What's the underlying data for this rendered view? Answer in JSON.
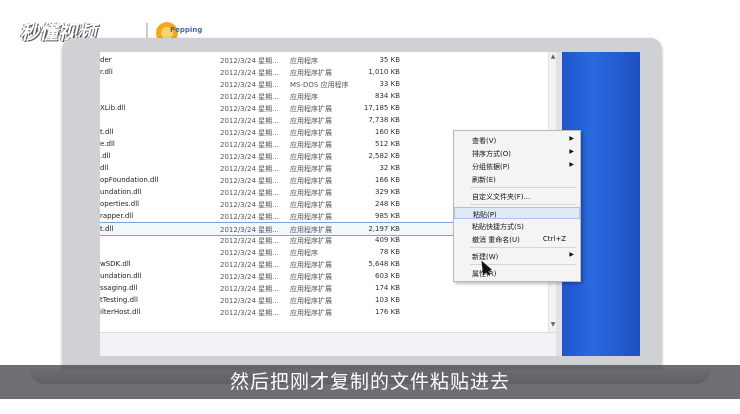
{
  "watermark": {
    "brand": "秒懂视频",
    "partner": "Pepping"
  },
  "files": [
    {
      "name": "der",
      "date": "2012/3/24 星期...",
      "type": "应用程序",
      "size": "35 KB"
    },
    {
      "name": "r.dll",
      "date": "2012/3/24 星期...",
      "type": "应用程序扩展",
      "size": "1,010 KB"
    },
    {
      "name": "",
      "date": "2012/3/24 星期...",
      "type": "MS-DOS 应用程序",
      "size": "33 KB"
    },
    {
      "name": "",
      "date": "2012/3/24 星期...",
      "type": "应用程序",
      "size": "834 KB"
    },
    {
      "name": "XLib.dll",
      "date": "2012/3/24 星期...",
      "type": "应用程序扩展",
      "size": "17,185 KB"
    },
    {
      "name": "",
      "date": "2012/3/24 星期...",
      "type": "应用程序扩展",
      "size": "7,738 KB"
    },
    {
      "name": "t.dll",
      "date": "2012/3/24 星期...",
      "type": "应用程序扩展",
      "size": "160 KB"
    },
    {
      "name": "e.dll",
      "date": "2012/3/24 星期...",
      "type": "应用程序扩展",
      "size": "512 KB"
    },
    {
      "name": ".dll",
      "date": "2012/3/24 星期...",
      "type": "应用程序扩展",
      "size": "2,582 KB"
    },
    {
      "name": "dll",
      "date": "2012/3/24 星期...",
      "type": "应用程序扩展",
      "size": "32 KB"
    },
    {
      "name": "opFoundation.dll",
      "date": "2012/3/24 星期...",
      "type": "应用程序扩展",
      "size": "166 KB"
    },
    {
      "name": "undation.dll",
      "date": "2012/3/24 星期...",
      "type": "应用程序扩展",
      "size": "329 KB"
    },
    {
      "name": "operties.dll",
      "date": "2012/3/24 星期...",
      "type": "应用程序扩展",
      "size": "248 KB"
    },
    {
      "name": "rapper.dll",
      "date": "2012/3/24 星期...",
      "type": "应用程序扩展",
      "size": "985 KB"
    },
    {
      "name": "t.dll",
      "date": "2012/3/24 星期...",
      "type": "应用程序扩展",
      "size": "2,197 KB",
      "selected": true
    },
    {
      "name": "",
      "date": "2012/3/24 星期...",
      "type": "应用程序扩展",
      "size": "409 KB"
    },
    {
      "name": "",
      "date": "2012/3/24 星期...",
      "type": "应用程序",
      "size": "78 KB"
    },
    {
      "name": "wSDK.dll",
      "date": "2012/3/24 星期...",
      "type": "应用程序扩展",
      "size": "5,648 KB"
    },
    {
      "name": "undation.dll",
      "date": "2012/3/24 星期...",
      "type": "应用程序扩展",
      "size": "603 KB"
    },
    {
      "name": "ssaging.dll",
      "date": "2012/3/24 星期...",
      "type": "应用程序扩展",
      "size": "174 KB"
    },
    {
      "name": "tTesting.dll",
      "date": "2012/3/24 星期...",
      "type": "应用程序扩展",
      "size": "103 KB"
    },
    {
      "name": "ilterHost.dll",
      "date": "2012/3/24 星期...",
      "type": "应用程序扩展",
      "size": "176 KB"
    }
  ],
  "context_menu": {
    "view": "查看(V)",
    "sort": "排序方式(O)",
    "group": "分组依据(P)",
    "refresh": "刷新(E)",
    "customize": "自定义文件夹(F)...",
    "paste": "粘贴(P)",
    "paste_shortcut": "粘贴快捷方式(S)",
    "undo_rename": "撤消 重命名(U)",
    "undo_shortcut": "Ctrl+Z",
    "new": "新建(W)",
    "properties": "属性(R)",
    "submenu_arrow": "▶"
  },
  "subtitle": "然后把刚才复制的文件粘贴进去",
  "colors": {
    "desktop_blue": "#2a6ae0",
    "menu_hover": "#e0e9f7",
    "subtitle_bg": "#46464b"
  }
}
